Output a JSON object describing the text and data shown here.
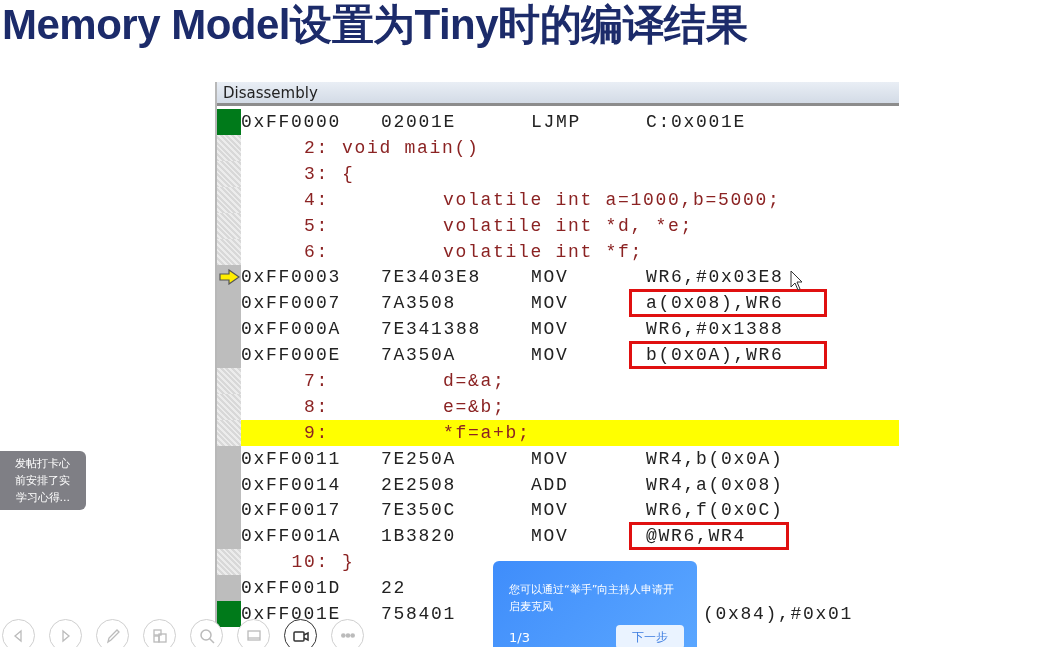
{
  "slide_title": "Memory Model设置为Tiny时的编译结果",
  "disassembly": {
    "title": "Disassembly",
    "rows": [
      {
        "kind": "asm",
        "breakpoint": true,
        "address": "0xFF0000",
        "opcode": "02001E",
        "mnemonic": "LJMP",
        "operand": "C:0x001E"
      },
      {
        "kind": "src_head",
        "number": "2:",
        "code": "void main()",
        "highlighted": false
      },
      {
        "kind": "src_head",
        "number": "3:",
        "code": "{",
        "highlighted": false
      },
      {
        "kind": "src",
        "number": "4:",
        "code": "volatile int a=1000,b=5000;",
        "highlighted": false
      },
      {
        "kind": "src",
        "number": "5:",
        "code": "volatile int *d, *e;",
        "highlighted": false
      },
      {
        "kind": "src",
        "number": "6:",
        "code": "volatile int *f;",
        "highlighted": false
      },
      {
        "kind": "asm",
        "current": true,
        "address": "0xFF0003",
        "opcode": "7E3403E8",
        "mnemonic": "MOV",
        "operand": "WR6,#0x03E8"
      },
      {
        "kind": "asm",
        "address": "0xFF0007",
        "opcode": "7A3508",
        "mnemonic": "MOV",
        "operand": "a(0x08),WR6",
        "boxed": true
      },
      {
        "kind": "asm",
        "address": "0xFF000A",
        "opcode": "7E341388",
        "mnemonic": "MOV",
        "operand": "WR6,#0x1388"
      },
      {
        "kind": "asm",
        "address": "0xFF000E",
        "opcode": "7A350A",
        "mnemonic": "MOV",
        "operand": "b(0x0A),WR6",
        "boxed": true
      },
      {
        "kind": "src",
        "number": "7:",
        "code": "d=&a;",
        "highlighted": false
      },
      {
        "kind": "src",
        "number": "8:",
        "code": "e=&b;",
        "highlighted": false
      },
      {
        "kind": "src",
        "number": "9:",
        "code": "*f=a+b;",
        "highlighted": true
      },
      {
        "kind": "asm",
        "address": "0xFF0011",
        "opcode": "7E250A",
        "mnemonic": "MOV",
        "operand": "WR4,b(0x0A)"
      },
      {
        "kind": "asm",
        "address": "0xFF0014",
        "opcode": "2E2508",
        "mnemonic": "ADD",
        "operand": "WR4,a(0x08)"
      },
      {
        "kind": "asm",
        "address": "0xFF0017",
        "opcode": "7E350C",
        "mnemonic": "MOV",
        "operand": "WR6,f(0x0C)"
      },
      {
        "kind": "asm",
        "address": "0xFF001A",
        "opcode": "1B3820",
        "mnemonic": "MOV",
        "operand": "@WR6,WR4",
        "boxed": true
      },
      {
        "kind": "src_head",
        "number": "10:",
        "code": "}",
        "highlighted": false
      },
      {
        "kind": "asm",
        "address": "0xFF001D",
        "opcode": "22"
      },
      {
        "kind": "asm",
        "breakpoint": true,
        "address": "0xFF001E",
        "opcode": "758401",
        "operand": "(0x84),#0x01"
      }
    ]
  },
  "chat_bubble": {
    "lines": [
      "发帖打卡心",
      "前安排了实",
      "学习心得..."
    ]
  },
  "tip_popup": {
    "text": "您可以通过“举手”向主持人申请开启麦克风",
    "page": "1/3",
    "button": "下一步"
  },
  "toolbar": {
    "items": [
      {
        "kind": "prev",
        "active": false
      },
      {
        "kind": "next",
        "active": false
      },
      {
        "kind": "pen",
        "active": false
      },
      {
        "kind": "layout",
        "active": false
      },
      {
        "kind": "zoom",
        "active": false
      },
      {
        "kind": "screen",
        "active": false
      },
      {
        "kind": "camera",
        "active": true
      },
      {
        "kind": "more",
        "active": false
      }
    ]
  }
}
